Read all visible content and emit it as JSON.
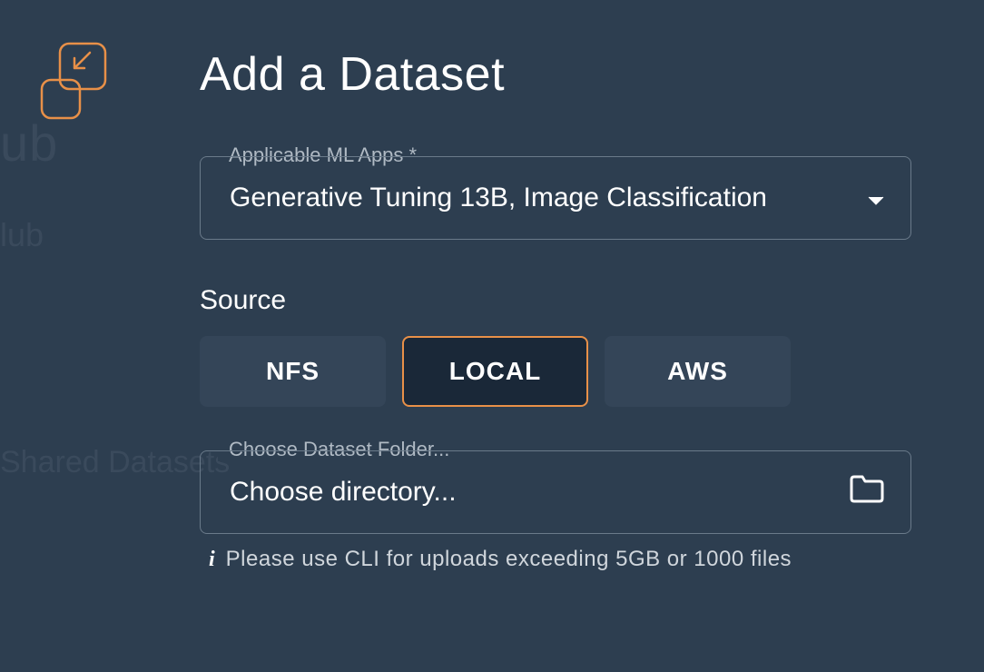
{
  "page": {
    "title": "Add a Dataset"
  },
  "background": {
    "text1": "ub",
    "text2": "lub",
    "text3": "Shared Datasets"
  },
  "form": {
    "mlApps": {
      "label": "Applicable ML Apps *",
      "selected": "Generative Tuning 13B, Image Classification"
    },
    "source": {
      "label": "Source",
      "options": [
        "NFS",
        "LOCAL",
        "AWS"
      ],
      "selected": "LOCAL"
    },
    "folder": {
      "label": "Choose Dataset Folder...",
      "placeholder": "Choose directory..."
    },
    "helper": "Please use CLI for uploads exceeding 5GB or 1000 files"
  }
}
